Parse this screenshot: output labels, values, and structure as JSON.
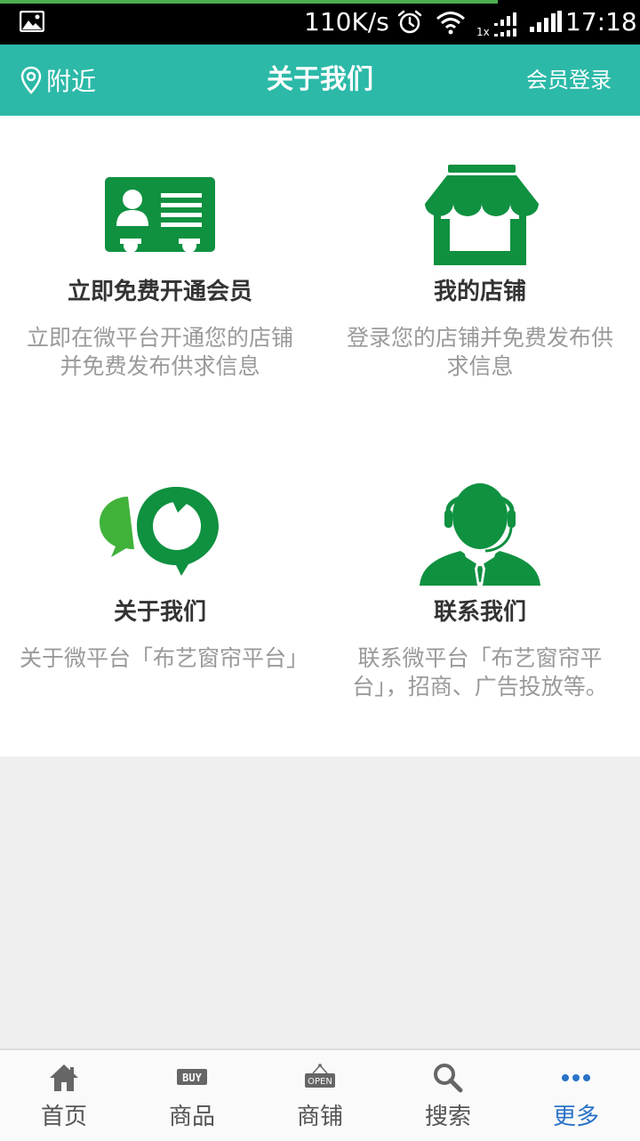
{
  "status_bar": {
    "network_speed": "110K/s",
    "signal_label": "1x",
    "time": "17:18"
  },
  "header": {
    "nearby_label": "附近",
    "title": "关于我们",
    "login_label": "会员登录",
    "background_color": "#2cb9a8"
  },
  "features": [
    {
      "icon": "member-card-icon",
      "title": "立即免费开通会员",
      "description": "立即在微平台开通您的店铺并免费发布供求信息"
    },
    {
      "icon": "storefront-icon",
      "title": "我的店铺",
      "description": "登录您的店铺并免费发布供求信息"
    },
    {
      "icon": "chat-bubbles-icon",
      "title": "关于我们",
      "description": "关于微平台「布艺窗帘平台」"
    },
    {
      "icon": "customer-service-icon",
      "title": "联系我们",
      "description": "联系微平台「布艺窗帘平台」，招商、广告投放等。"
    }
  ],
  "accent_green": "#0f9140",
  "bottom_nav": {
    "active_index": 4,
    "active_color": "#2a73c8",
    "items": [
      {
        "label": "首页",
        "icon": "home-icon"
      },
      {
        "label": "商品",
        "icon": "buy-tag-icon",
        "icon_text": "BUY"
      },
      {
        "label": "商铺",
        "icon": "open-sign-icon",
        "icon_text": "OPEN"
      },
      {
        "label": "搜索",
        "icon": "search-icon"
      },
      {
        "label": "更多",
        "icon": "more-icon"
      }
    ]
  }
}
